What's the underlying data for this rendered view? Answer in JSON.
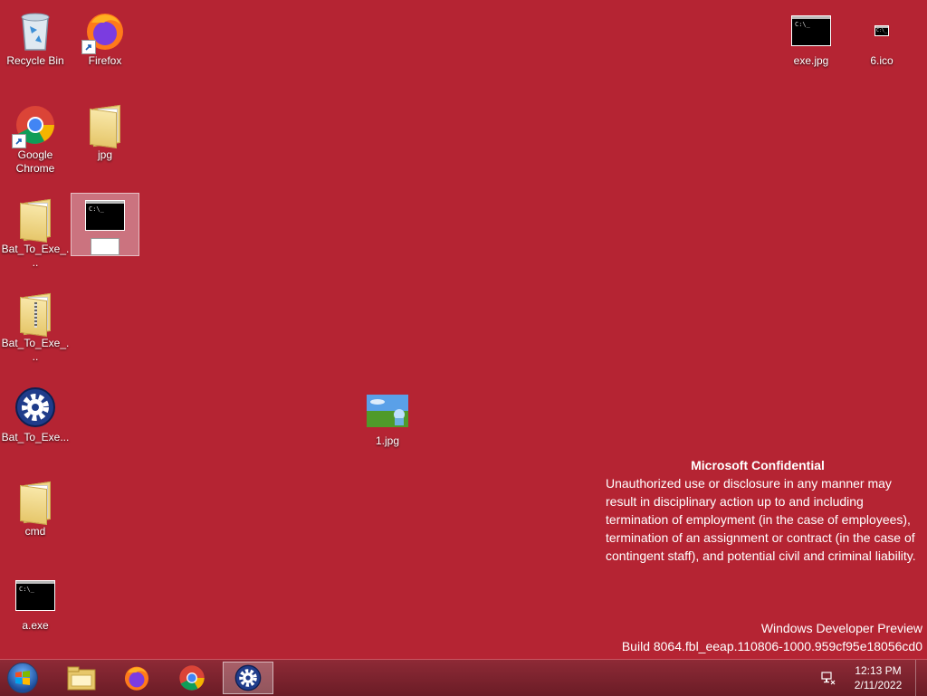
{
  "desktop": {
    "icons": [
      {
        "label": "Recycle Bin"
      },
      {
        "label": "Firefox"
      },
      {
        "label": "Google Chrome"
      },
      {
        "label": "jpg"
      },
      {
        "label": "Bat_To_Exe_..."
      },
      {
        "label": ""
      },
      {
        "label": "Bat_To_Exe_..."
      },
      {
        "label": "Bat_To_Exe..."
      },
      {
        "label": "cmd"
      },
      {
        "label": "a.exe"
      },
      {
        "label": "1.jpg"
      },
      {
        "label": "exe.jpg"
      },
      {
        "label": "6.ico"
      }
    ],
    "cmd_thumb_text": "C:\\_"
  },
  "watermark": {
    "heading": "Microsoft Confidential",
    "body": "Unauthorized use or disclosure in any manner may result in disciplinary action up to and including termination of employment (in the case of employees), termination of an assignment or contract (in the case of contingent staff), and potential civil and criminal liability.",
    "product": "Windows Developer Preview",
    "build": "Build 8064.fbl_eeap.110806-1000.959cf95e18056cd0"
  },
  "taskbar": {
    "buttons": [
      {
        "name": "file-explorer"
      },
      {
        "name": "firefox"
      },
      {
        "name": "chrome"
      },
      {
        "name": "bat-to-exe",
        "active": true
      }
    ],
    "clock": {
      "time": "12:13 PM",
      "date": "2/11/2022"
    }
  },
  "colors": {
    "desktop_bg": "#b52433",
    "taskbar": "#7a1f2b"
  }
}
